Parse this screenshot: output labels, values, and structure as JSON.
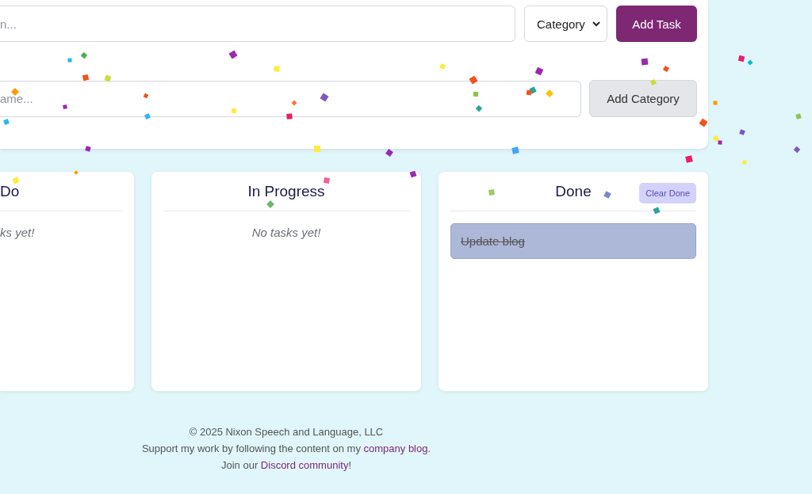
{
  "task_form": {
    "task_input": {
      "placeholder": "n..."
    },
    "category_select": {
      "value": "Category"
    },
    "add_button": "Add Task"
  },
  "category_form": {
    "category_input": {
      "placeholder": "ame..."
    },
    "add_button": "Add Category"
  },
  "columns": [
    {
      "title": "Do",
      "empty_text": "ks yet!"
    },
    {
      "title": "In Progress",
      "empty_text": "No tasks yet!"
    },
    {
      "title": "Done",
      "clear_button": "Clear Done",
      "tasks": [
        {
          "text": "Update blog",
          "done": true
        }
      ]
    }
  ],
  "footer": {
    "copyright": "© 2025 Nixon Speech and Language, LLC",
    "support_text": "Support my work by following the content on my ",
    "support_link": "company blog",
    "support_end": ".",
    "join_text": "Join our ",
    "join_link": "Discord community",
    "join_end": "!"
  }
}
